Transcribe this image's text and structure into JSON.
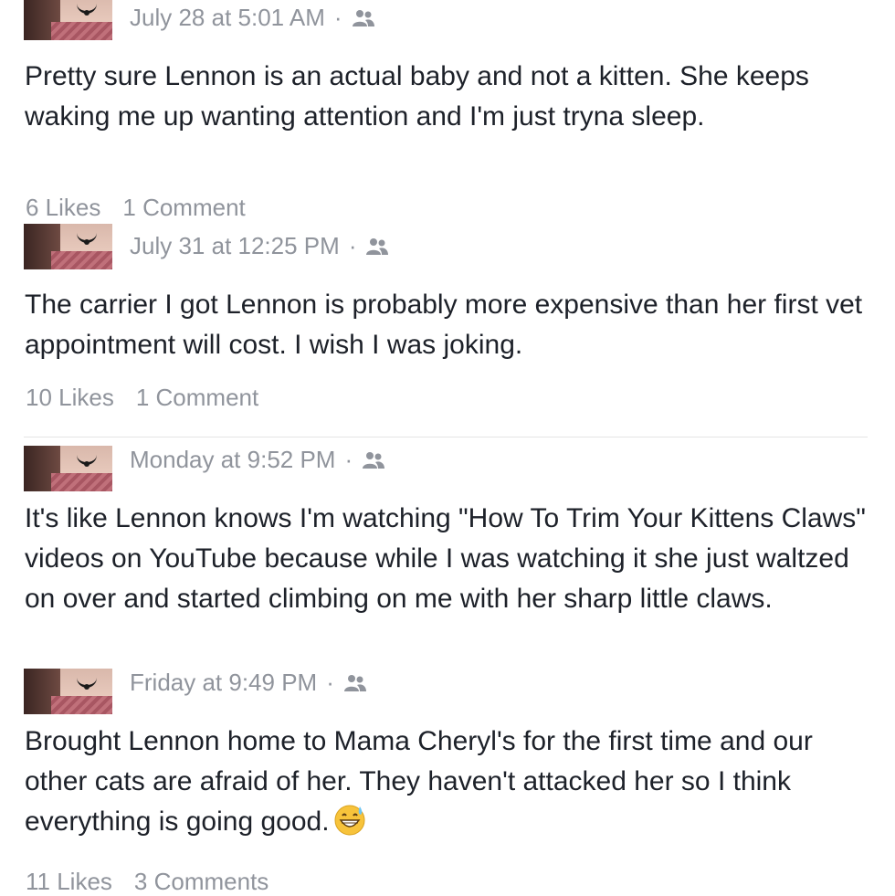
{
  "posts": [
    {
      "timestamp": "July 28 at 5:01 AM",
      "separator": "·",
      "privacy_icon": "friends-icon",
      "text": "Pretty sure Lennon is an actual baby and not a kitten. She keeps waking me up wanting attention and I'm just tryna sleep.",
      "likes": "6 Likes",
      "comments": "1 Comment"
    },
    {
      "timestamp": "July 31 at 12:25 PM",
      "separator": "·",
      "privacy_icon": "friends-icon",
      "text": "The carrier I got Lennon is probably more expensive than her first vet appointment will cost. I wish I was joking.",
      "likes": "10 Likes",
      "comments": "1 Comment"
    },
    {
      "timestamp": "Monday at 9:52 PM",
      "separator": "·",
      "privacy_icon": "friends-icon",
      "text": "It's like Lennon knows I'm watching \"How To Trim Your Kittens Claws\" videos on YouTube because while I was watching it she just waltzed on over and started climbing on me with her sharp little claws."
    },
    {
      "timestamp": "Friday at 9:49 PM",
      "separator": "·",
      "privacy_icon": "friends-icon",
      "text": "Brought Lennon home to Mama Cheryl's for the first time and our other cats are afraid of her. They haven't attacked her so I think everything is going good.",
      "emoji": "grinning-sweat-emoji",
      "likes": "11 Likes",
      "comments": "3 Comments"
    }
  ]
}
